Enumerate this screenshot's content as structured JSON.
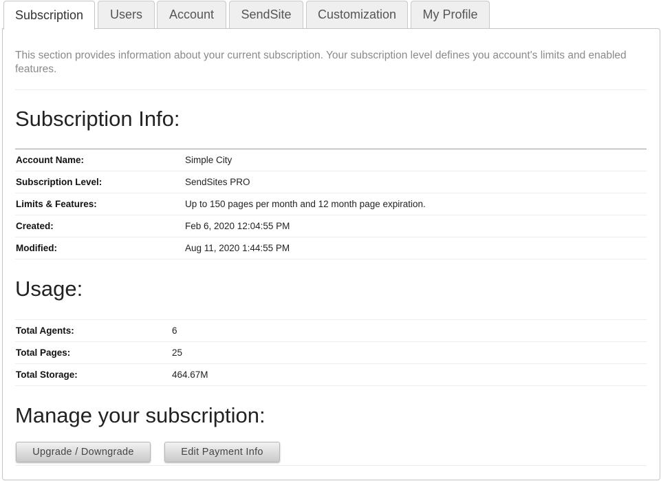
{
  "tabs": [
    {
      "label": "Subscription"
    },
    {
      "label": "Users"
    },
    {
      "label": "Account"
    },
    {
      "label": "SendSite"
    },
    {
      "label": "Customization"
    },
    {
      "label": "My Profile"
    }
  ],
  "active_tab": "Subscription",
  "intro_text": "This section provides information about your current subscription. Your subscription level defines you account's limits and enabled features.",
  "subscription_info": {
    "heading": "Subscription Info:",
    "rows": [
      {
        "label": "Account Name:",
        "value": "Simple City"
      },
      {
        "label": "Subscription Level:",
        "value": "SendSites PRO"
      },
      {
        "label": "Limits & Features:",
        "value": "Up to 150 pages per month and 12 month page expiration."
      },
      {
        "label": "Created:",
        "value": "Feb 6, 2020 12:04:55 PM"
      },
      {
        "label": "Modified:",
        "value": "Aug 11, 2020 1:44:55 PM"
      }
    ]
  },
  "usage": {
    "heading": "Usage:",
    "rows": [
      {
        "label": "Total Agents:",
        "value": "6"
      },
      {
        "label": "Total Pages:",
        "value": "25"
      },
      {
        "label": "Total Storage:",
        "value": "464.67M"
      }
    ]
  },
  "manage": {
    "heading": "Manage your subscription:",
    "upgrade_label": "Upgrade / Downgrade",
    "payment_label": "Edit Payment Info"
  }
}
